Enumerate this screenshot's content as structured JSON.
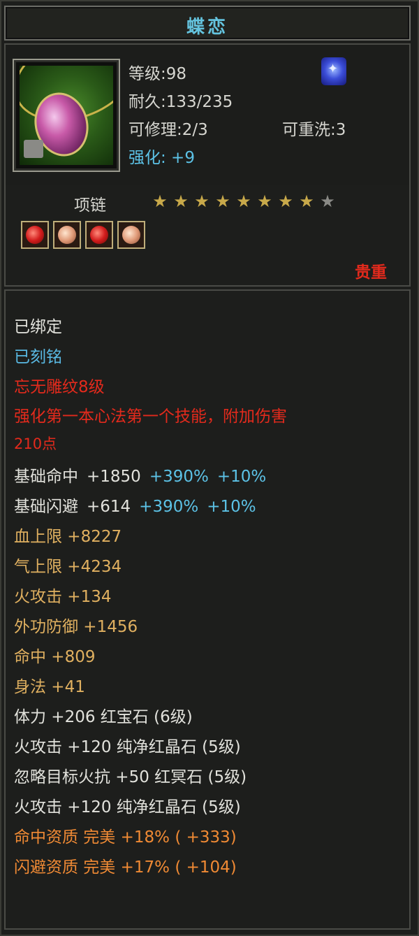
{
  "item": {
    "name": "蝶恋",
    "stats": {
      "level": "等级:98",
      "durability": "耐久:133/235",
      "repairable": "可修理:2/3",
      "rewashable": "可重洗:3",
      "enhance": "强化: +9"
    },
    "slot_type": "项链",
    "stars_total": 9,
    "stars_lit": 8,
    "sockets": [
      "red-gem",
      "pale-gem",
      "red-gem",
      "pale-gem"
    ],
    "rarity": "贵重"
  },
  "colors": {
    "title": "#64c3de",
    "white": "#e2e2dc",
    "blue": "#59b8e2",
    "red": "#e32a1c",
    "gold": "#e0b060",
    "orange": "#f08a34",
    "cyan": "#5cc2e6"
  },
  "lines": {
    "bound": "已绑定",
    "engraved": "已刻铭",
    "engrave_name": "忘无雕纹8级",
    "engrave_desc1": "强化第一本心法第一个技能，附加伤害",
    "engrave_desc2": "210点",
    "hit": {
      "label": "基础命中",
      "value": "+1850",
      "bonus1": "+390%",
      "bonus2": "+10%"
    },
    "dodge": {
      "label": "基础闪避",
      "value": "+614",
      "bonus1": "+390%",
      "bonus2": "+10%"
    },
    "hp": "血上限 +8227",
    "qi": "气上限 +4234",
    "fire_atk": "火攻击 +134",
    "ext_def": "外功防御 +1456",
    "accuracy": "命中 +809",
    "agility": "身法 +41",
    "gem1": "体力 +206 红宝石 (6级)",
    "gem2": "火攻击 +120 纯净红晶石 (5级)",
    "gem3": "忽略目标火抗 +50 红冥石 (5级)",
    "gem4": "火攻击 +120 纯净红晶石 (5级)",
    "quality1": "命中资质  完美 +18% ( +333)",
    "quality2": "闪避资质  完美 +17% ( +104)"
  }
}
